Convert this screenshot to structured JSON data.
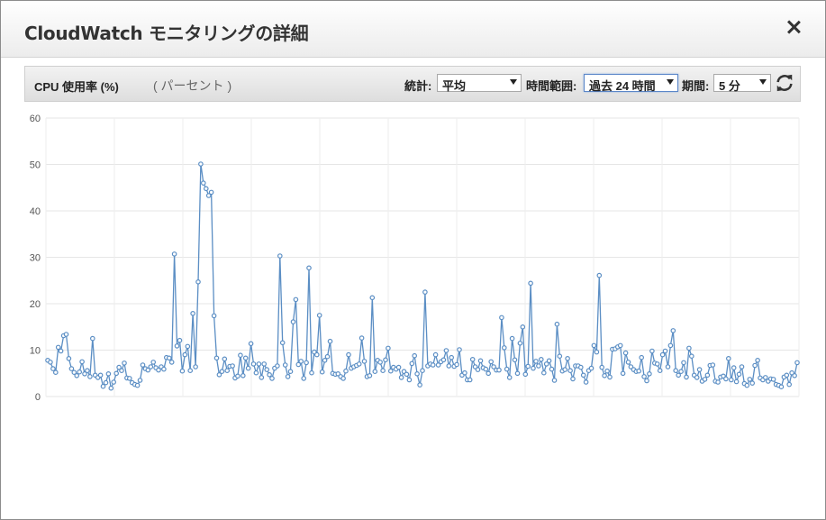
{
  "dialog": {
    "title": "CloudWatch モニタリングの詳細",
    "close_icon": "close-icon"
  },
  "panel": {
    "metric": "CPU 使用率 (%)",
    "unit": "( パーセント )",
    "stat_label": "統計:",
    "stat_value": "平均",
    "range_label": "時間範囲:",
    "range_value": "過去 24 時間",
    "period_label": "期間:",
    "period_value": "5 分",
    "refresh_icon": "refresh-icon"
  },
  "chart_data": {
    "type": "line",
    "ylim": [
      0,
      60
    ],
    "yticks": [
      "60",
      "50",
      "40",
      "30",
      "20",
      "10",
      "0"
    ],
    "grid": true,
    "color": "#5b8ec4",
    "series": [
      {
        "values": [
          7.8,
          7.4,
          6,
          5.2,
          10.6,
          9.8,
          13.1,
          13.4,
          8.2,
          6,
          5.2,
          4.5,
          5.3,
          7.5,
          4.9,
          5.6,
          4.3,
          12.5,
          4.6,
          4.1,
          4.6,
          2.2,
          3,
          4.9,
          1.8,
          3.1,
          5,
          6.3,
          5.6,
          7.2,
          4,
          3.9,
          3,
          2.6,
          2.4,
          3.5,
          6.8,
          6,
          5.7,
          6.4,
          7.4,
          6.2,
          5.7,
          6.4,
          5.9,
          8.4,
          8.3,
          7.4,
          30.7,
          10.9,
          12.1,
          5.5,
          9,
          10.8,
          5.6,
          17.9,
          6.4,
          24.7,
          50.1,
          46,
          44.8,
          43.3,
          44,
          17.4,
          8.3,
          4.7,
          5.4,
          8.1,
          5.6,
          6.5,
          6.6,
          4,
          4.4,
          8.9,
          4.5,
          8.3,
          6.1,
          11.4,
          7,
          5.1,
          7,
          4.1,
          7,
          5.8,
          4.7,
          3.9,
          6.1,
          6.6,
          30.3,
          11.6,
          6.8,
          4.3,
          5.4,
          16.1,
          20.9,
          6.9,
          7.6,
          3.9,
          7.3,
          27.7,
          5.1,
          9.6,
          9,
          17.5,
          5.3,
          7.8,
          8.6,
          11.9,
          5,
          4.8,
          4.9,
          4.3,
          3.9,
          5.5,
          9,
          6.1,
          6.4,
          6.7,
          7,
          12.6,
          7.6,
          4.3,
          4.5,
          21.3,
          5.4,
          7.8,
          7.4,
          5.6,
          7.9,
          10.4,
          5.5,
          6.3,
          5.9,
          6.3,
          4.1,
          5.4,
          4.8,
          3.6,
          7.1,
          8.8,
          4.9,
          2.5,
          5.6,
          22.5,
          6.6,
          7,
          6.8,
          9,
          6.8,
          7.5,
          7.9,
          9.9,
          6.6,
          8.4,
          6.5,
          6.9,
          10.1,
          4.6,
          5.1,
          3.6,
          3.6,
          8,
          6.4,
          5.8,
          7.7,
          6.2,
          5.9,
          5,
          7.5,
          6.4,
          5.7,
          5.7,
          17,
          10.5,
          5.9,
          4.1,
          12.5,
          7.9,
          5,
          11.5,
          15,
          4.8,
          6.5,
          24.4,
          6.1,
          7.6,
          6.6,
          8,
          5.1,
          7,
          7.7,
          5.9,
          3.5,
          15.6,
          8.7,
          5.5,
          5.8,
          8.2,
          5.6,
          3.8,
          6.6,
          6.6,
          6.3,
          4.6,
          3.1,
          5.6,
          6.1,
          11,
          9.6,
          26.1,
          6.3,
          4.5,
          5.5,
          4.2,
          10.2,
          10.3,
          10.7,
          11,
          5,
          9.4,
          7.4,
          6.4,
          5.8,
          5.4,
          5.5,
          8.4,
          4.3,
          3.4,
          4.9,
          9.8,
          7.2,
          7,
          5.6,
          9,
          9.8,
          6.4,
          11,
          14.2,
          5.6,
          4.6,
          5.4,
          7.3,
          4.2,
          10.4,
          8.7,
          4.6,
          4.1,
          5.8,
          3.3,
          3.7,
          4.6,
          6.7,
          6.8,
          3.3,
          3.1,
          4.2,
          4.4,
          3.8,
          8.2,
          3.6,
          6.2,
          3.2,
          4.8,
          6.4,
          2.8,
          2.4,
          3.7,
          2.9,
          6.7,
          7.8,
          4,
          3.6,
          4.1,
          3.3,
          3.8,
          3.7,
          2.6,
          2.4,
          2.1,
          4.2,
          4.6,
          2.6,
          5.1,
          4.5,
          7.3
        ]
      }
    ]
  }
}
